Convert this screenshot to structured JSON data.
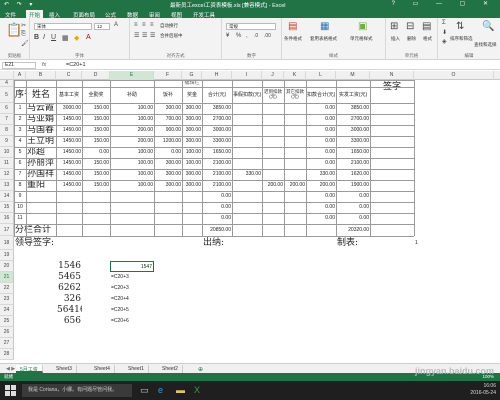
{
  "window": {
    "title": "最新员工excel工资表模板.xls [兼容模式] - Excel",
    "quick_access": "↶ ↷ ▾",
    "controls": "? ▭ — ▢ ✕"
  },
  "tabs": [
    "文件",
    "开始",
    "插入",
    "页面布局",
    "公式",
    "数据",
    "审阅",
    "视图",
    "开发工具"
  ],
  "ribbon": {
    "font_name": "宋体",
    "font_size": "12",
    "number_format": "常规",
    "wrap_text": "自动换行",
    "merge_center": "合并后居中",
    "cond_format": "条件格式",
    "table_format": "套用表格格式",
    "cell_styles": "单元格样式",
    "insert": "插入",
    "delete": "删除",
    "format": "格式",
    "sort_filter": "排序和筛选",
    "find_select": "查找和选择",
    "groups": [
      "剪贴板",
      "字体",
      "对齐方式",
      "数字",
      "样式",
      "单元格",
      "编辑"
    ]
  },
  "formula_bar": {
    "name_box": "E21",
    "fx": "fx",
    "formula": "=C20+1"
  },
  "columns": [
    "A",
    "B",
    "C",
    "D",
    "E",
    "F",
    "G",
    "H",
    "I",
    "J",
    "K",
    "L",
    "M",
    "N",
    "O"
  ],
  "selected_column": "E",
  "rows": [
    "4",
    "5",
    "6",
    "7",
    "8",
    "9",
    "10",
    "11",
    "12",
    "13",
    "14",
    "15",
    "16",
    "17",
    "18",
    "19",
    "20",
    "21",
    "22",
    "23",
    "24",
    "25",
    "26",
    "27",
    "28"
  ],
  "selected_row": "21",
  "table_header": {
    "seq": "序号",
    "name": "姓名",
    "base": "基本工资",
    "allowance": "全勤奖",
    "subsidy": "补助",
    "meal": "饭补",
    "bonus": "奖金",
    "total": "合计(元)",
    "leave_deduct": "事假扣款(元)",
    "late_deduct": "迟到扣款(元)",
    "other_deduct": "其它扣款(元)",
    "deduct_total": "扣款合计(元)",
    "actual": "实发工资(元)",
    "sign": "签字",
    "header_note": "编辑栏"
  },
  "employees": [
    {
      "seq": "1",
      "name": "马云霞",
      "base": "3000.00",
      "allow": "150.00",
      "sub": "100.00",
      "meal": "300.00",
      "bonus": "300.00",
      "total": "3850.00",
      "leave": "",
      "late": "",
      "other": "",
      "ded": "0.00",
      "actual": "3850.00"
    },
    {
      "seq": "2",
      "name": "马亚娟",
      "base": "1450.00",
      "allow": "150.00",
      "sub": "100.00",
      "meal": "700.00",
      "bonus": "300.00",
      "total": "2700.00",
      "leave": "",
      "late": "",
      "other": "",
      "ded": "0.00",
      "actual": "2700.00"
    },
    {
      "seq": "3",
      "name": "马国春",
      "base": "1450.00",
      "allow": "150.00",
      "sub": "200.00",
      "meal": "900.00",
      "bonus": "300.00",
      "total": "3000.00",
      "leave": "",
      "late": "",
      "other": "",
      "ded": "0.00",
      "actual": "3000.00"
    },
    {
      "seq": "4",
      "name": "王立明",
      "base": "1450.00",
      "allow": "150.00",
      "sub": "200.00",
      "meal": "1200.00",
      "bonus": "300.00",
      "total": "3300.00",
      "leave": "",
      "late": "",
      "other": "",
      "ded": "0.00",
      "actual": "3300.00"
    },
    {
      "seq": "5",
      "name": "邓超",
      "base": "1450.00",
      "allow": "0.00",
      "sub": "100.00",
      "meal": "0.00",
      "bonus": "100.00",
      "total": "1650.00",
      "leave": "",
      "late": "",
      "other": "",
      "ded": "0.00",
      "actual": "1650.00"
    },
    {
      "seq": "6",
      "name": "孙丽萍",
      "base": "1450.00",
      "allow": "150.00",
      "sub": "100.00",
      "meal": "300.00",
      "bonus": "100.00",
      "total": "2100.00",
      "leave": "",
      "late": "",
      "other": "",
      "ded": "0.00",
      "actual": "2100.00"
    },
    {
      "seq": "7",
      "name": "孙国祥",
      "base": "1450.00",
      "allow": "150.00",
      "sub": "100.00",
      "meal": "300.00",
      "bonus": "300.00",
      "total": "2100.00",
      "leave": "330.00",
      "late": "",
      "other": "",
      "ded": "330.00",
      "actual": "1620.00"
    },
    {
      "seq": "8",
      "name": "董阳",
      "base": "1450.00",
      "allow": "150.00",
      "sub": "100.00",
      "meal": "300.00",
      "bonus": "300.00",
      "total": "2100.00",
      "leave": "",
      "late": "200.00",
      "other": "200.00",
      "ded": "200.00",
      "actual": "1900.00"
    },
    {
      "seq": "9",
      "name": "",
      "base": "",
      "allow": "",
      "sub": "",
      "meal": "",
      "bonus": "",
      "total": "0.00",
      "leave": "",
      "late": "",
      "other": "",
      "ded": "0.00",
      "actual": "0.00"
    },
    {
      "seq": "10",
      "name": "",
      "base": "",
      "allow": "",
      "sub": "",
      "meal": "",
      "bonus": "",
      "total": "0.00",
      "leave": "",
      "late": "",
      "other": "",
      "ded": "0.00",
      "actual": "0.00"
    },
    {
      "seq": "11",
      "name": "",
      "base": "",
      "allow": "",
      "sub": "",
      "meal": "",
      "bonus": "",
      "total": "0.00",
      "leave": "",
      "late": "",
      "other": "",
      "ded": "0.00",
      "actual": "0.00"
    }
  ],
  "subtotal": {
    "label": "分栏合计",
    "total": "20850.00",
    "actual": "20320.00"
  },
  "signatures": {
    "leader": "领导签字:",
    "cashier": "出纳:",
    "maker": "制表:"
  },
  "stray_cell": "1",
  "calc": {
    "values": [
      "1546",
      "5465",
      "6262",
      "326",
      "5641654",
      "656"
    ],
    "formulas": [
      "1547",
      "=C20+3",
      "=C20+3",
      "=C20+4",
      "=C20+5",
      "=C20+6"
    ]
  },
  "sheet_tabs": [
    "5月工资",
    "Sheet3",
    "Sheet4",
    "Sheet1",
    "Sheet2",
    "⊕"
  ],
  "status": {
    "left": "就绪",
    "right": "100%"
  },
  "taskbar": {
    "search": "我是 Cortana，小娜。有问题尽管问我。",
    "time": "16:06",
    "date": "2016-05-24"
  },
  "watermark": "jingyan.baidu.com"
}
